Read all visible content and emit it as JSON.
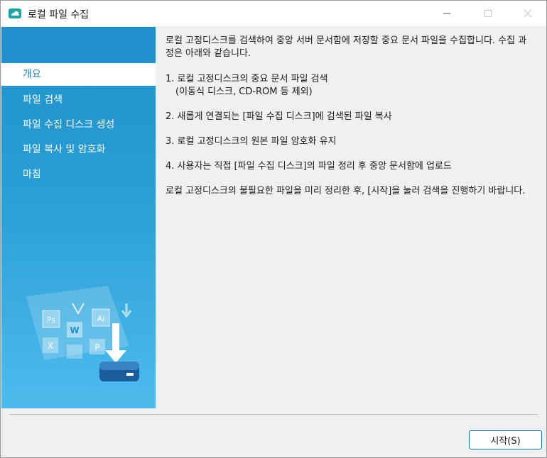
{
  "window": {
    "title": "로컬 파일 수집",
    "icon": "cloud-app-icon"
  },
  "sidebar": {
    "items": [
      {
        "label": "개요",
        "active": true
      },
      {
        "label": "파일 검색",
        "active": false
      },
      {
        "label": "파일 수집 디스크 생성",
        "active": false
      },
      {
        "label": "파일 복사 및 암호화",
        "active": false
      },
      {
        "label": "마침",
        "active": false
      }
    ],
    "illustration": {
      "badges": [
        "Ps",
        "Ai",
        "W",
        "X",
        "P"
      ]
    }
  },
  "content": {
    "intro": "로컬 고정디스크를 검색하여 중앙 서버 문서함에 저장할 중요 문서 파일을 수집합니다. 수집 과정은 아래와 같습니다.",
    "steps": [
      "1. 로컬 고정디스크의 중요 문서 파일 검색",
      "(이동식 디스크, CD-ROM 등 제외)",
      "2. 새롭게 연결되는 [파일 수집 디스크]에 검색된 파일 복사",
      "3. 로컬 고정디스크의 원본 파일 암호화 유지",
      "4. 사용자는 직접 [파일 수집 디스크]의 파일 정리 후 중앙 문서함에 업로드"
    ],
    "outro": "로컬 고정디스크의 불필요한 파일을 미리 정리한 후, [시작]을 눌러 검색을 진행하기 바랍니다."
  },
  "footer": {
    "start_label": "시작(S)"
  },
  "colors": {
    "sidebar_top": "#1f8fcb",
    "sidebar_bottom": "#4dbbec",
    "accent": "#0f6fb7"
  }
}
